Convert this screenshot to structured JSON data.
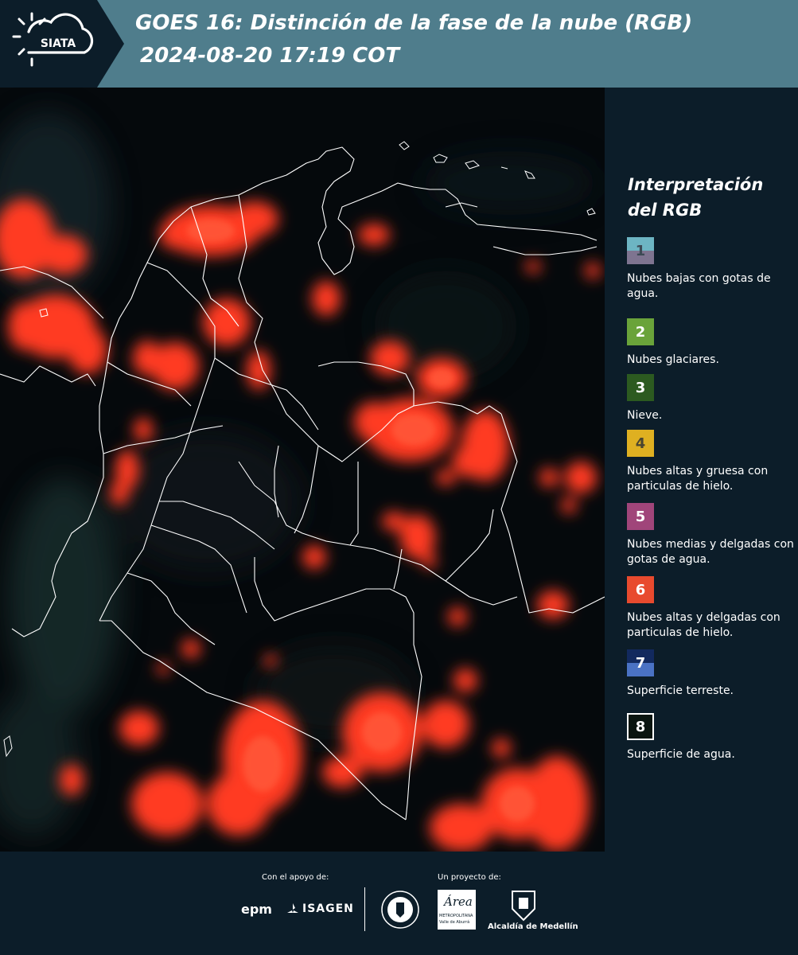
{
  "header": {
    "logo_text": "SIATA",
    "title_line1": "GOES 16: Distinción de la fase de la nube (RGB)",
    "title_line2": "2024-08-20 17:19 COT",
    "background_color": "#4f7d8c"
  },
  "legend": {
    "title": "Interpretación del RGB",
    "items": [
      {
        "number": "1",
        "label": "Nubes bajas con gotas de agua.",
        "color_top": "#6db5c3",
        "color_bottom": "#7e7490",
        "text_color": "#3d4a55"
      },
      {
        "number": "2",
        "label": "Nubes glaciares.",
        "color_top": "#6aa33a",
        "color_bottom": "#6aa33a",
        "text_color": "#ffffff"
      },
      {
        "number": "3",
        "label": "Nieve.",
        "color_top": "#2c5a20",
        "color_bottom": "#2c5a20",
        "text_color": "#ffffff"
      },
      {
        "number": "4",
        "label": "Nubes altas y gruesa con particulas de hielo.",
        "color_top": "#dfb021",
        "color_bottom": "#dfb021",
        "text_color": "#4a4530"
      },
      {
        "number": "5",
        "label": "Nubes medias y delgadas con gotas de agua.",
        "color_top": "#a0457a",
        "color_bottom": "#a0457a",
        "text_color": "#ffffff"
      },
      {
        "number": "6",
        "label": "Nubes altas y delgadas con particulas de hielo.",
        "color_top": "#e84a2e",
        "color_bottom": "#e84a2e",
        "text_color": "#ffffff"
      },
      {
        "number": "7",
        "label": "Superficie terreste.",
        "color_top": "#12295e",
        "color_bottom": "#4a72c4",
        "text_color": "#ffffff"
      },
      {
        "number": "8",
        "label": "Superficie de agua.",
        "color_top": "#0a1510",
        "color_bottom": "#0a1510",
        "text_color": "#ffffff"
      }
    ]
  },
  "footer": {
    "support_label": "Con el apoyo de:",
    "project_label": "Un proyecto de:",
    "epm_text": "epm",
    "isagen_text": "ISAGEN",
    "area_text": "Área",
    "area_subtext": "METROPOLITANA",
    "area_subtext2": "Valle de Aburrá",
    "alcaldia_text": "Alcaldía de Medellín"
  }
}
